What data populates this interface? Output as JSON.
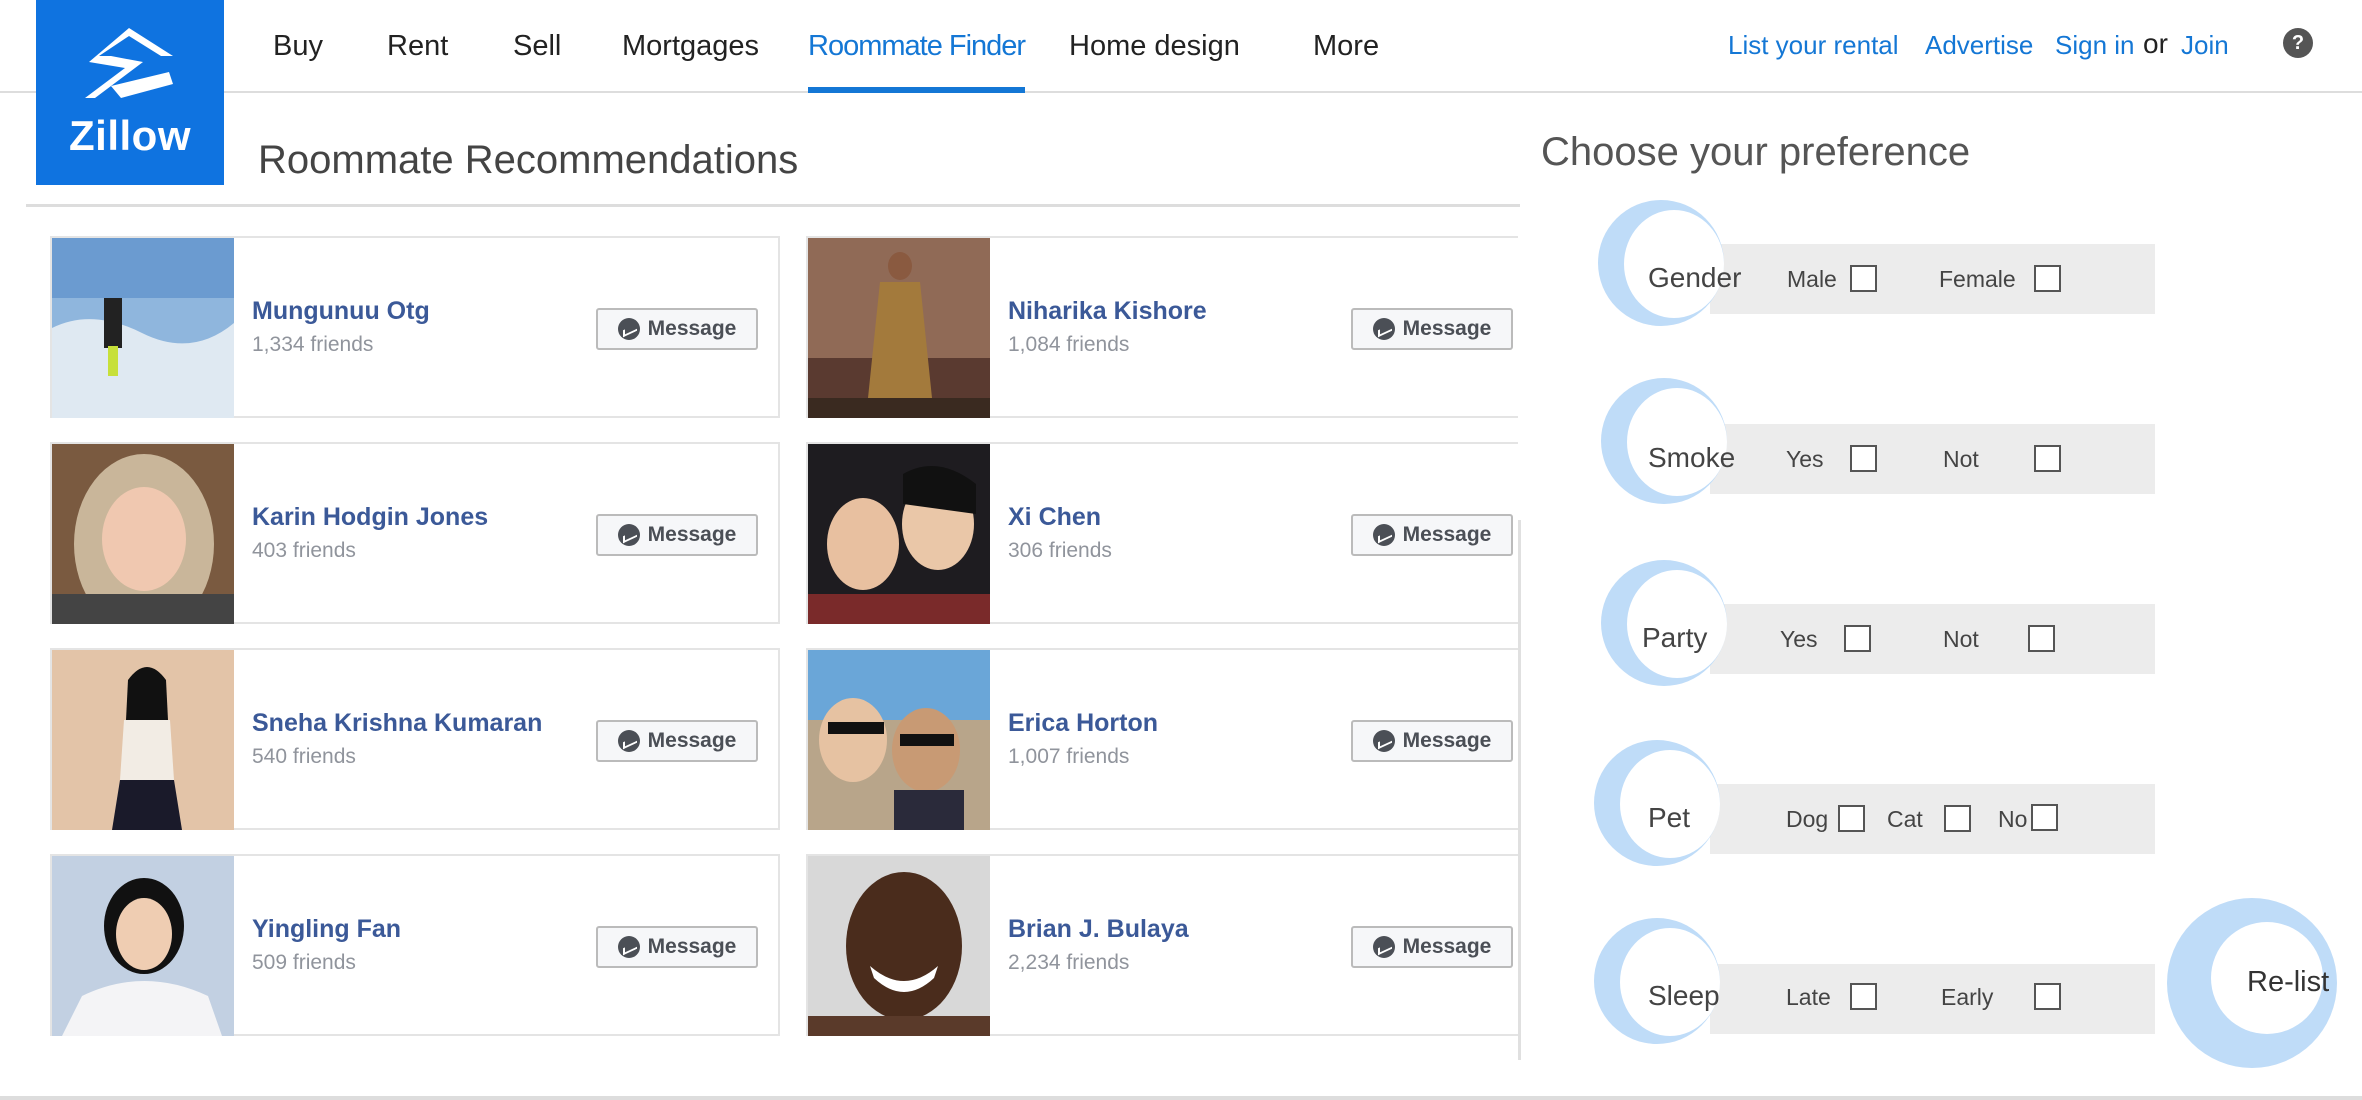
{
  "brand": {
    "name": "Zillow",
    "color": "#0f73e0"
  },
  "nav": {
    "items": [
      "Buy",
      "Rent",
      "Sell",
      "Mortgages",
      "Roommate Finder",
      "Home design",
      "More"
    ],
    "active": "Roommate Finder"
  },
  "top_links": {
    "list_rental": "List your rental",
    "advertise": "Advertise",
    "sign_in": "Sign in",
    "or": "or",
    "join": "Join",
    "help": "?"
  },
  "recommendations": {
    "title": "Roommate Recommendations",
    "message_label": "Message",
    "people": [
      {
        "name": "Mungunuu Otg",
        "friends": "1,334 friends"
      },
      {
        "name": "Niharika Kishore",
        "friends": "1,084 friends"
      },
      {
        "name": "Karin Hodgin Jones",
        "friends": "403 friends"
      },
      {
        "name": "Xi Chen",
        "friends": "306 friends"
      },
      {
        "name": "Sneha Krishna Kumaran",
        "friends": "540 friends"
      },
      {
        "name": "Erica Horton",
        "friends": "1,007 friends"
      },
      {
        "name": "Yingling Fan",
        "friends": "509 friends"
      },
      {
        "name": "Brian J. Bulaya",
        "friends": "2,234 friends"
      }
    ]
  },
  "preferences": {
    "title": "Choose your preference",
    "groups": [
      {
        "label": "Gender",
        "options": [
          "Male",
          "Female"
        ]
      },
      {
        "label": "Smoke",
        "options": [
          "Yes",
          "Not"
        ]
      },
      {
        "label": "Party",
        "options": [
          "Yes",
          "Not"
        ]
      },
      {
        "label": "Pet",
        "options": [
          "Dog",
          "Cat",
          "No"
        ]
      },
      {
        "label": "Sleep",
        "options": [
          "Late",
          "Early"
        ]
      }
    ],
    "relist_label": "Re-list"
  }
}
